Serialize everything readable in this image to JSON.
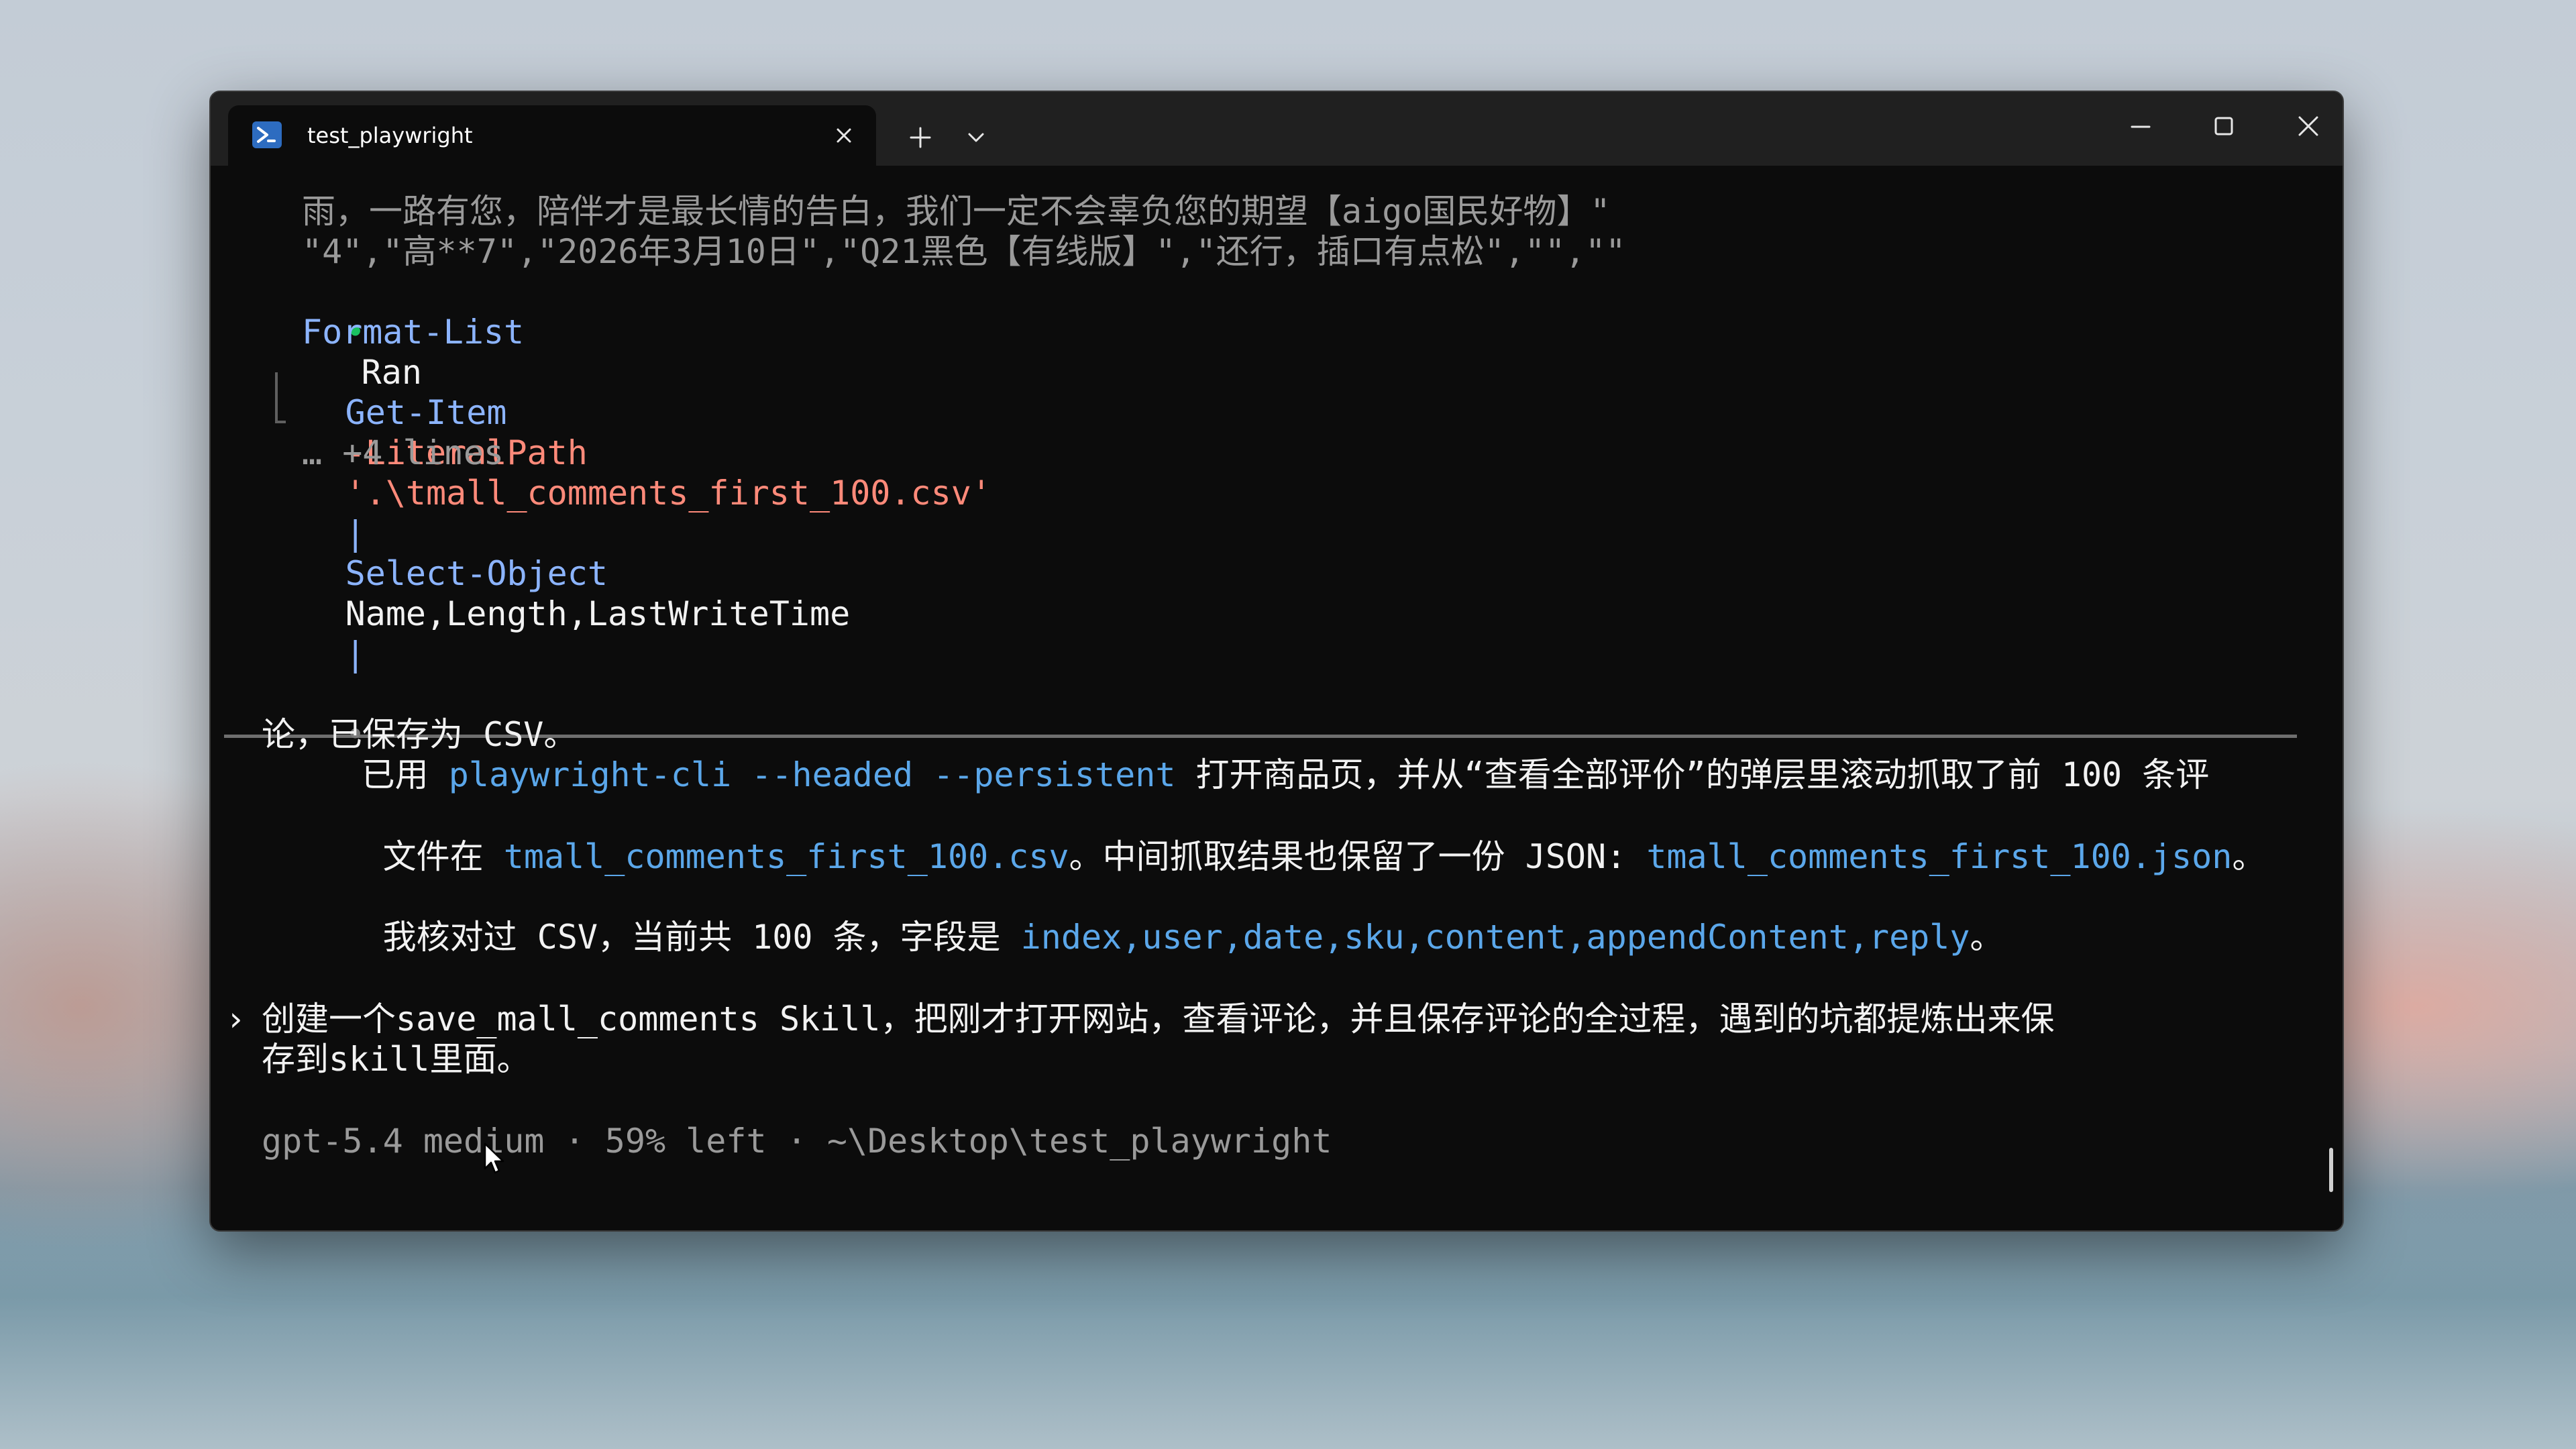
{
  "window": {
    "tab_title": "test_playwright",
    "icons": {
      "tab": "powershell-icon",
      "close_tab": "close-icon",
      "new_tab": "plus-icon",
      "dropdown": "chevron-down-icon",
      "minimize": "minimize-icon",
      "maximize": "maximize-icon",
      "close_window": "close-icon"
    }
  },
  "terminal": {
    "csv_tail": {
      "line1": "雨，一路有您，陪伴才是最长情的告白，我们一定不会辜负您的期望【aigo国民好物】\"",
      "line2": "\"4\",\"高**7\",\"2026年3月10日\",\"Q21黑色【有线版】\",\"还行，插口有点松\",\"\",\"\""
    },
    "ran": {
      "bullet": "•",
      "label": "Ran",
      "cmd1": "Get-Item",
      "param1": "-LiteralPath",
      "path": "'.\\tmall_comments_first_100.csv'",
      "pipe1": "|",
      "cmd2": "Select-Object",
      "args": "Name,Length,LastWriteTime",
      "pipe2": "|",
      "cmd3": "Format-List",
      "more_lines": "… +4 lines"
    },
    "reply": {
      "bullet": "•",
      "p1_prefix": "已用 ",
      "p1_code": "playwright-cli --headed --persistent",
      "p1_suffix": " 打开商品页，并从“查看全部评价”的弹层里滚动抓取了前 100 条评",
      "p1_line2": "论，已保存为 CSV。",
      "p2_prefix": "文件在 ",
      "p2_code1": "tmall_comments_first_100.csv",
      "p2_mid": "。中间抓取结果也保留了一份 JSON: ",
      "p2_code2": "tmall_comments_first_100.json",
      "p2_suffix": "。",
      "p3_prefix": "我核对过 CSV，当前共 100 条，字段是 ",
      "p3_code": "index,user,date,sku,content,appendContent,reply",
      "p3_suffix": "。"
    },
    "prompt": {
      "chevron": "›",
      "line1": "创建一个save_mall_comments Skill，把刚才打开网站，查看评论，并且保存评论的全过程，遇到的坑都提炼出来保",
      "line2": "存到skill里面。"
    },
    "status": "gpt-5.4 medium · 59% left · ~\\Desktop\\test_playwright"
  },
  "colors": {
    "terminal_bg": "#0c0c0c",
    "titlebar_bg": "#202020",
    "accent_blue": "#5ba7ea",
    "success_green": "#19c160",
    "param_red": "#ff8a7a"
  }
}
